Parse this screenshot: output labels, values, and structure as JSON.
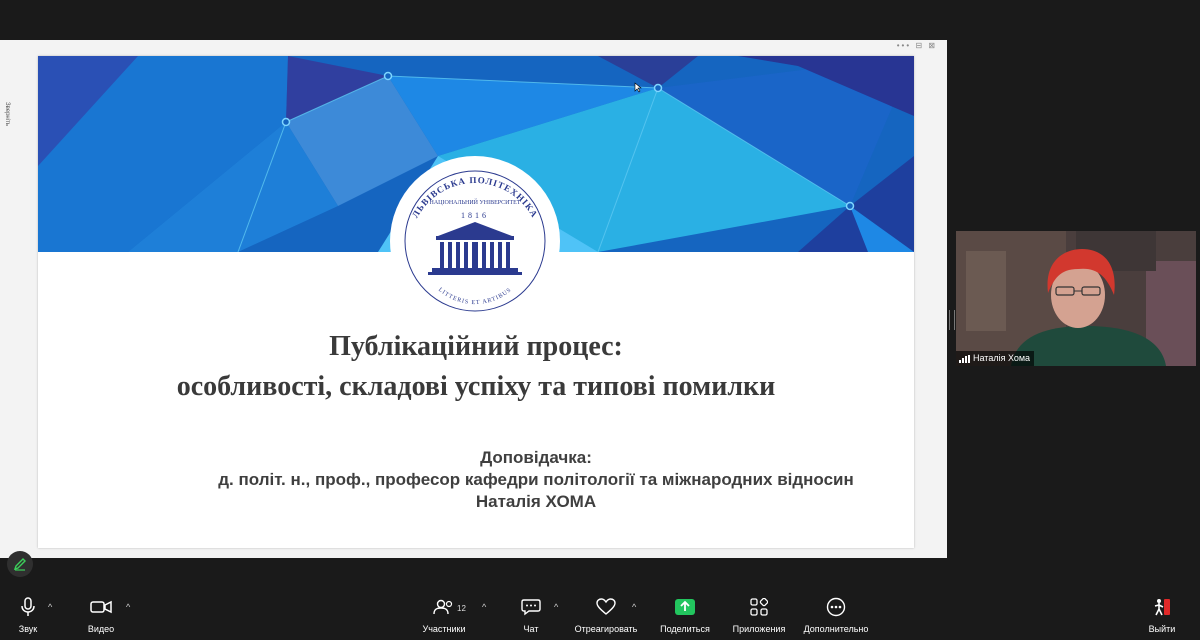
{
  "share": {
    "side_panel_text": "Зверніть",
    "window_controls": "••• ⊟ ⊠"
  },
  "slide": {
    "logo": {
      "arc_text": "НАЦІОНАЛЬНИЙ УНІВЕРСИТЕТ",
      "name": "ЛЬВІВСЬКА ПОЛІТЕХНІКА",
      "year": "1816",
      "motto": "LITTERIS ET ARTIBUS"
    },
    "title_line1": "Публікаційний процес:",
    "title_line2": "особливості, складові успіху та типові помилки",
    "speaker_label": "Доповідачка:",
    "speaker_position": "д. політ. н., проф., професор кафедри політології та міжнародних відносин",
    "speaker_name": "Наталія ХОМА"
  },
  "video": {
    "participant_name": "Наталія Хома"
  },
  "toolbar": {
    "audio": "Звук",
    "video": "Видео",
    "participants": "Участники",
    "participants_count": "12",
    "chat": "Чат",
    "react": "Отреагировать",
    "share": "Поделиться",
    "apps": "Приложения",
    "more": "Дополнительно",
    "leave": "Выйти"
  },
  "colors": {
    "meeting_bg": "#1a1a1a",
    "banner_blue": "#1565c0",
    "banner_cyan": "#29b6e6",
    "banner_navy": "#283593",
    "logo_blue": "#2b3a8f",
    "share_green": "#22c55e",
    "leave_red": "#e02828"
  }
}
